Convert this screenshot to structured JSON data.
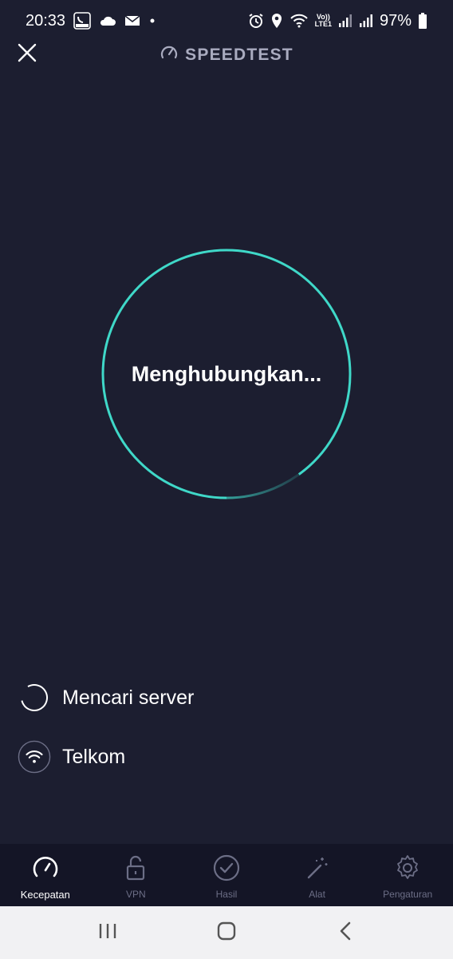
{
  "status_bar": {
    "time": "20:33",
    "battery": "97%",
    "left_icons": [
      "imo-icon",
      "cloud-icon",
      "mail-icon",
      "dot-icon"
    ],
    "right_icons": [
      "alarm-icon",
      "location-icon",
      "wifi-icon",
      "volte-lte-icon",
      "signal-icon",
      "signal-icon",
      "battery-icon"
    ],
    "volte_line1": "Vo))",
    "volte_line2": "LTE1"
  },
  "header": {
    "title": "SPEEDTEST",
    "close_icon": "close-icon",
    "brand_icon": "speedometer-icon"
  },
  "test": {
    "status_text": "Menghubungkan...",
    "ring_color": "#3fd8c8",
    "progress": 0.9
  },
  "server": {
    "search_label": "Mencari server",
    "provider": "Telkom"
  },
  "tabs": [
    {
      "label": "Kecepatan",
      "icon": "speedometer-icon",
      "active": true
    },
    {
      "label": "VPN",
      "icon": "unlock-icon",
      "active": false
    },
    {
      "label": "Hasil",
      "icon": "check-circle-icon",
      "active": false
    },
    {
      "label": "Alat",
      "icon": "magic-wand-icon",
      "active": false
    },
    {
      "label": "Pengaturan",
      "icon": "gear-icon",
      "active": false
    }
  ],
  "colors": {
    "background": "#1c1e30",
    "tabbar": "#141526",
    "accent": "#3fd8c8",
    "muted": "#6c6e86"
  }
}
